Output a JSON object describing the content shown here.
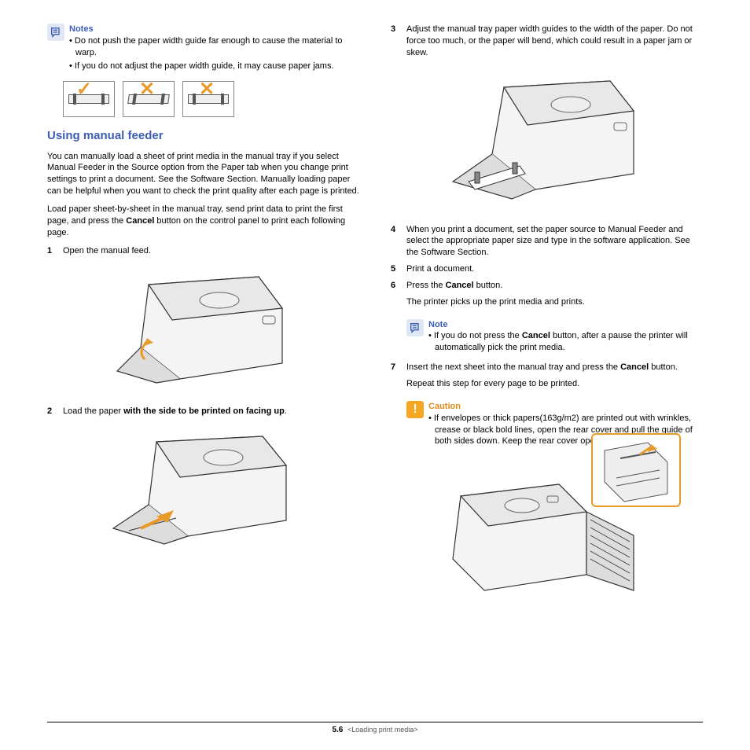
{
  "left": {
    "notes_title": "Notes",
    "notes": [
      "Do not push the paper width guide far enough to cause the material to warp.",
      "If you do not adjust the paper width guide, it may cause paper jams."
    ],
    "heading": "Using manual feeder",
    "intro1": "You can manually load a sheet of print media in the manual tray if you select Manual Feeder in the Source option from the Paper tab when you change print settings to print a document. See the Software Section. Manually loading paper can be helpful when you want to check the print quality after each page is printed.",
    "intro2_a": "Load paper sheet-by-sheet in the manual tray, send print data to print the first page, and press the ",
    "intro2_b": "Cancel",
    "intro2_c": " button on the control panel to print each following page.",
    "step1_num": "1",
    "step1": "Open the manual feed.",
    "step2_num": "2",
    "step2_a": "Load the paper ",
    "step2_b": "with the side to be printed on facing up",
    "step2_c": "."
  },
  "right": {
    "step3_num": "3",
    "step3": "Adjust the manual tray paper width guides to the width of the paper. Do not force too much, or the paper will bend, which could result in a paper jam or skew.",
    "step4_num": "4",
    "step4": "When you print a document, set the paper source to Manual Feeder and select the appropriate paper size and type in the software application. See the Software Section.",
    "step5_num": "5",
    "step5": "Print a document.",
    "step6_num": "6",
    "step6_a": "Press the ",
    "step6_b": "Cancel",
    "step6_c": " button.",
    "step6_after": "The printer picks up the print media and prints.",
    "note_title": "Note",
    "note_a": "If you do not press the ",
    "note_b": "Cancel",
    "note_c": " button, after a pause the printer will automatically pick the print media.",
    "step7_num": "7",
    "step7_a": "Insert the next sheet into the manual tray and press the ",
    "step7_b": "Cancel",
    "step7_c": " button.",
    "step7_after": "Repeat this step for every page to be printed.",
    "caution_title": "Caution",
    "caution": "If envelopes or thick papers(163g/m2) are printed out with wrinkles, crease or black bold lines, open the rear cover and pull the guide of both sides down. Keep the rear cover opened during printing."
  },
  "footer": {
    "chapter": "5",
    "page": ".6",
    "crumb": "<Loading print media>"
  }
}
